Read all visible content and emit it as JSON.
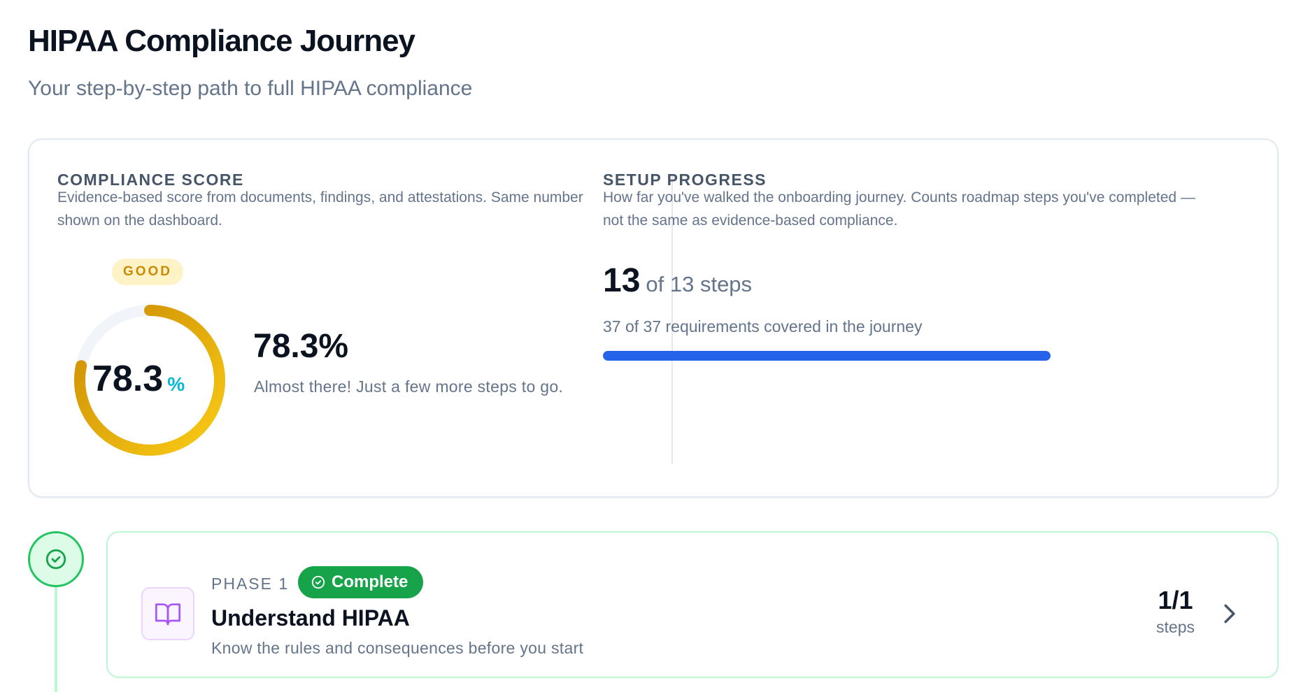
{
  "header": {
    "title": "HIPAA Compliance Journey",
    "subtitle": "Your step-by-step path to full HIPAA compliance"
  },
  "compliance_score": {
    "heading": "COMPLIANCE SCORE",
    "description": "Evidence-based score from documents, findings, and attestations. Same number shown on the dashboard.",
    "badge": "GOOD",
    "gauge_value": "78.3",
    "gauge_unit": "%",
    "gauge_fraction": 0.783,
    "score_text": "78.3%",
    "message": "Almost there! Just a few more steps to go.",
    "colors": {
      "badge_bg": "#fef3c7",
      "badge_text": "#ca8a04",
      "ring_start": "#facc15",
      "ring_end": "#ca8a04",
      "unit": "#06b6d4"
    }
  },
  "setup_progress": {
    "heading": "SETUP PROGRESS",
    "description": "How far you've walked the onboarding journey. Counts roadmap steps you've completed — not the same as evidence-based compliance.",
    "steps_done": "13",
    "steps_of_text": "of 13 steps",
    "requirements_text": "37 of 37 requirements covered in the journey",
    "progress_fraction": 1.0,
    "progress_color": "#2563eb"
  },
  "phases": [
    {
      "label": "PHASE 1",
      "status": "Complete",
      "title": "Understand HIPAA",
      "description": "Know the rules and consequences before you start",
      "count": "1/1",
      "count_label": "steps",
      "icon": "book-open-icon",
      "status_color": "#16a34a"
    }
  ]
}
